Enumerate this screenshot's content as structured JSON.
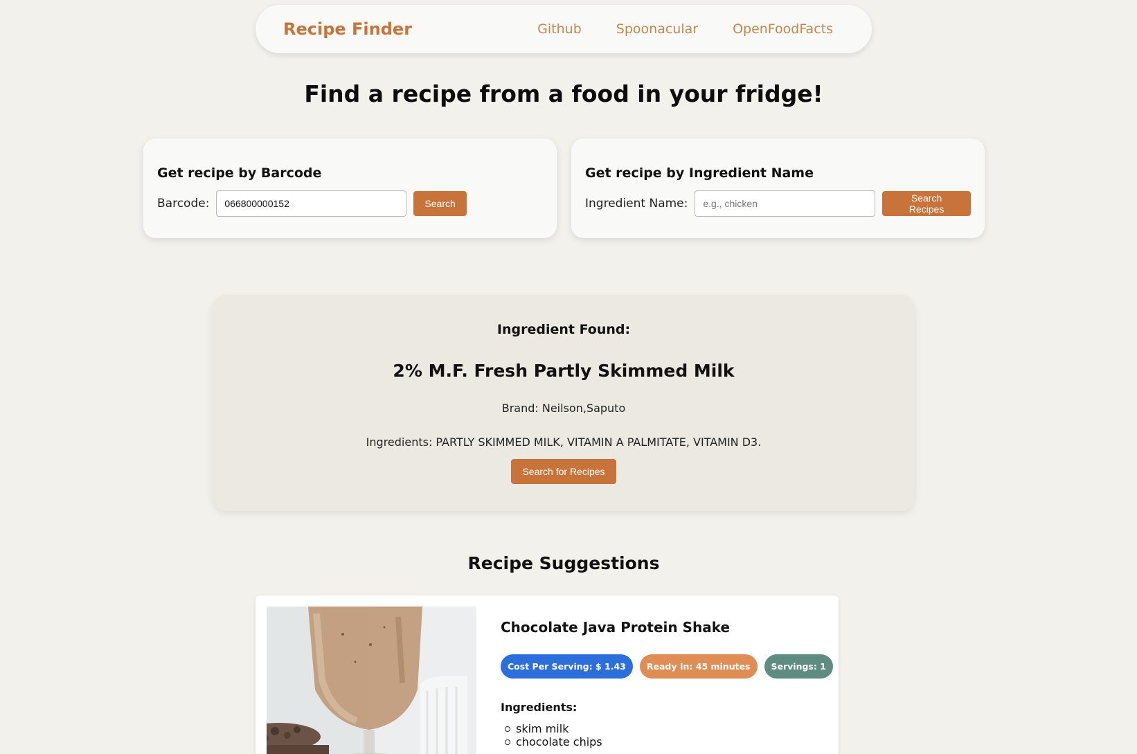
{
  "nav": {
    "brand": "Recipe Finder",
    "links": [
      "Github",
      "Spoonacular",
      "OpenFoodFacts"
    ]
  },
  "headline": "Find a recipe from a food in your fridge!",
  "barcode_card": {
    "title": "Get recipe by Barcode",
    "label": "Barcode:",
    "value": "066800000152",
    "button": "Search"
  },
  "ingredient_card": {
    "title": "Get recipe by Ingredient Name",
    "label": "Ingredient Name:",
    "placeholder": "e.g., chicken",
    "button": "Search Recipes"
  },
  "found": {
    "label": "Ingredient Found:",
    "product_name": "2% M.F. Fresh Partly Skimmed Milk",
    "brand": "Brand: Neilson,Saputo",
    "ingredients": "Ingredients: PARTLY SKIMMED MILK, VITAMIN A PALMITATE, VITAMIN D3.",
    "button": "Search for Recipes"
  },
  "suggestions": {
    "title": "Recipe Suggestions",
    "recipes": [
      {
        "title": "Chocolate Java Protein Shake",
        "cost": "Cost Per Serving: $ 1.43",
        "ready": "Ready In: 45 minutes",
        "servings": "Servings: 1",
        "ingredients_heading": "Ingredients:",
        "ingredients": [
          "skim milk",
          "chocolate chips"
        ]
      }
    ]
  },
  "colors": {
    "accent": "#c8733a",
    "background": "#f2f1ec",
    "badge_cost": "#2c6fdc",
    "badge_time": "#e08d55",
    "badge_servings": "#5f8c80"
  }
}
